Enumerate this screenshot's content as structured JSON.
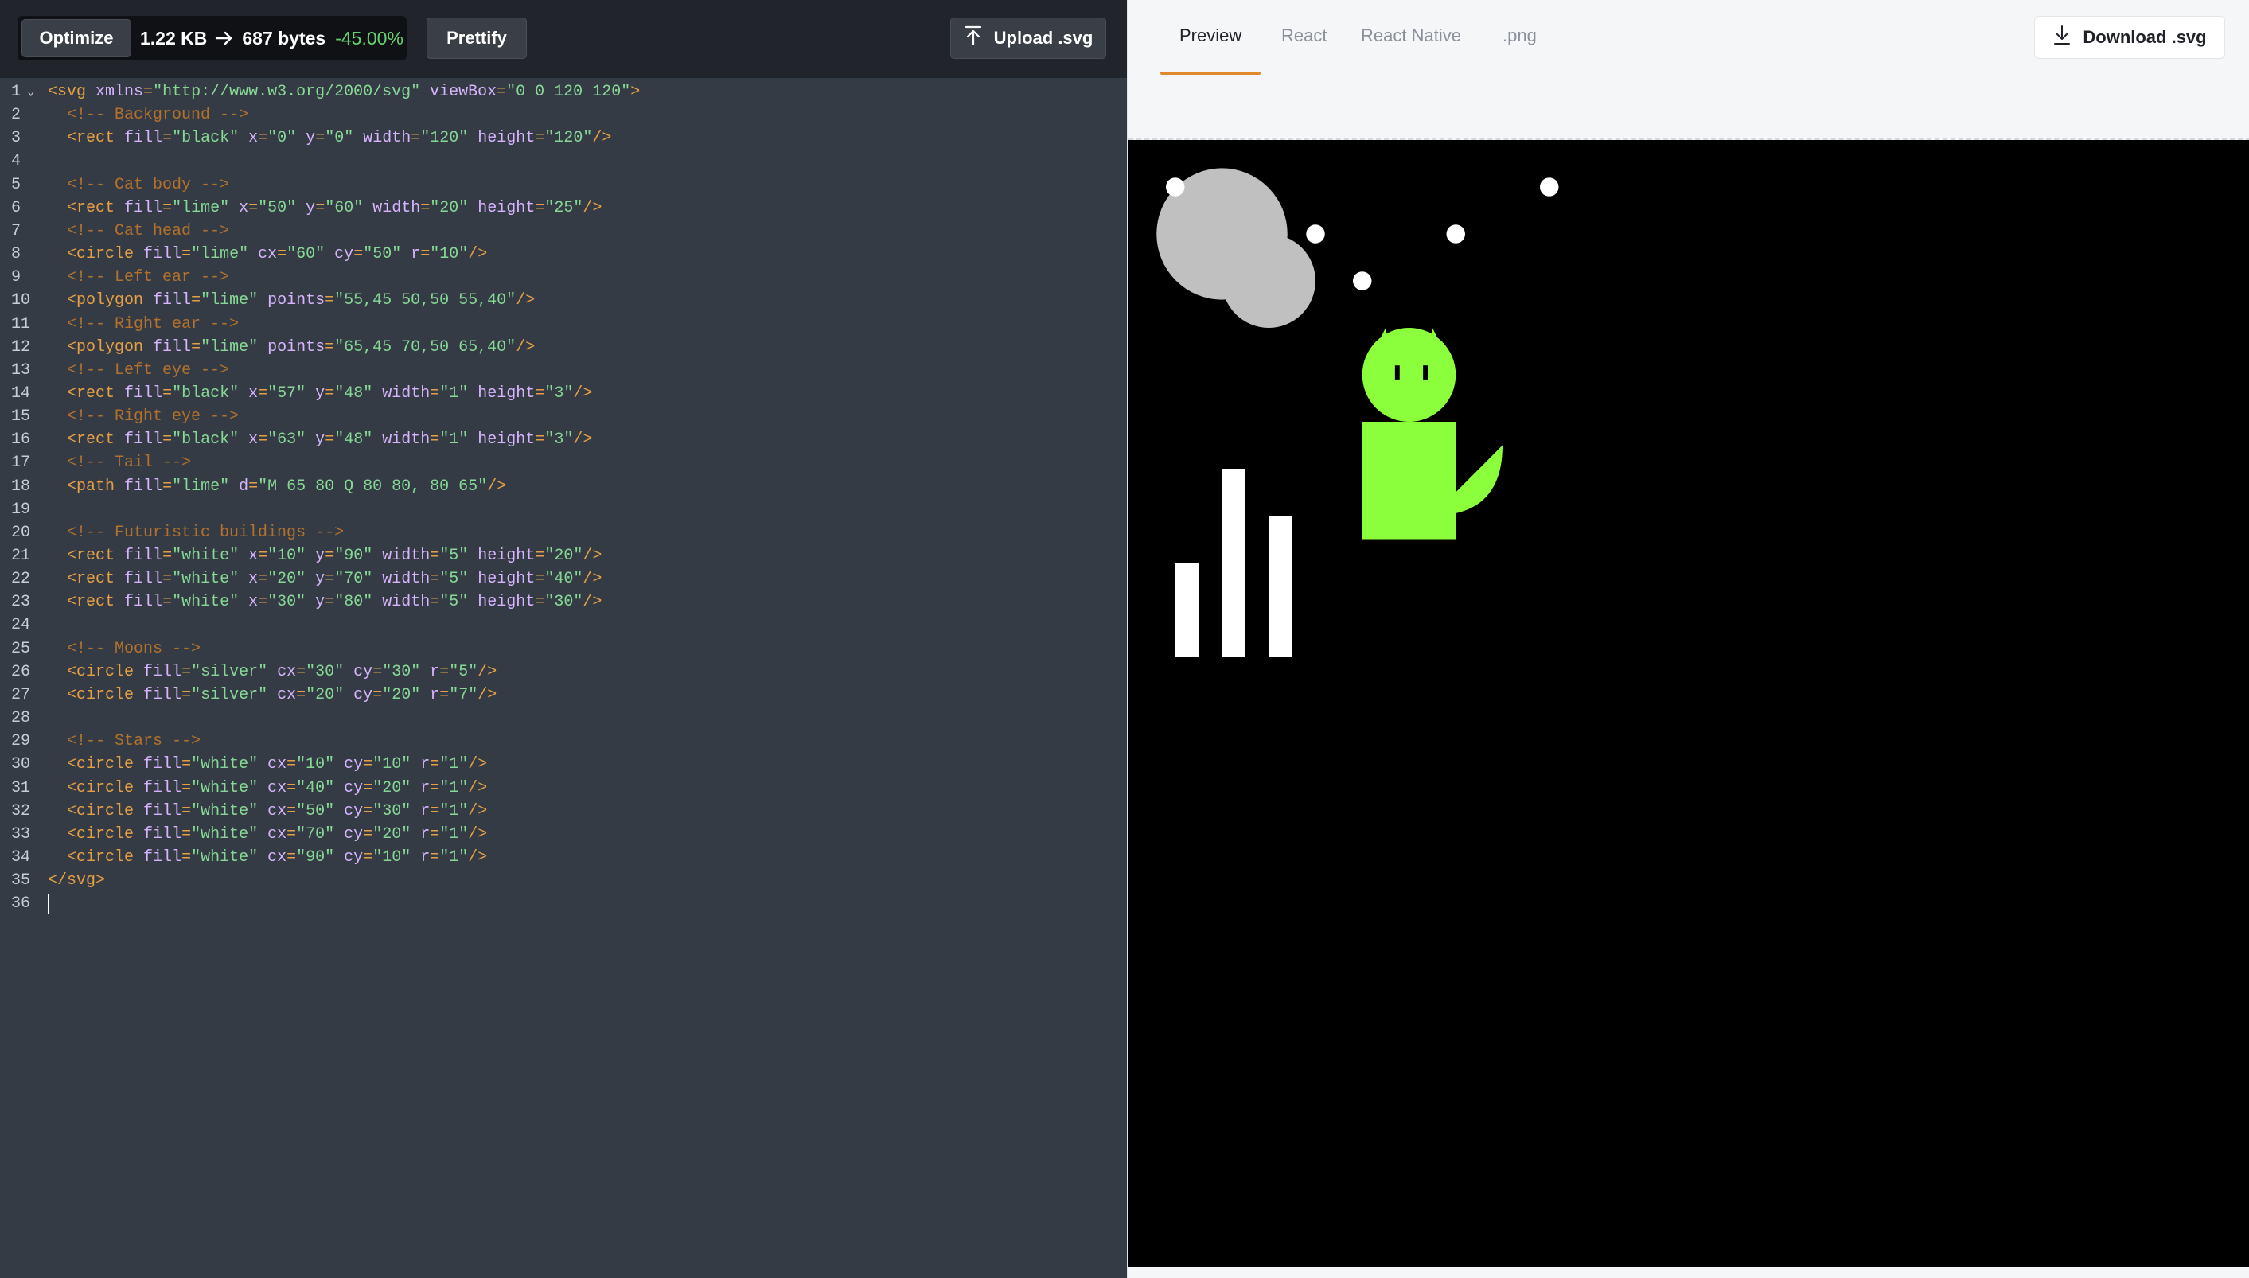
{
  "toolbar": {
    "optimize_label": "Optimize",
    "size_before": "1.22 KB",
    "size_after": "687 bytes",
    "size_change": "-45.00%",
    "prettify_label": "Prettify",
    "upload_label": "Upload .svg",
    "upload_icon": "upload-icon",
    "arrow_icon": "arrow-right-icon"
  },
  "editor": {
    "line_numbers": [
      "1",
      "2",
      "3",
      "4",
      "5",
      "6",
      "7",
      "8",
      "9",
      "10",
      "11",
      "12",
      "13",
      "14",
      "15",
      "16",
      "17",
      "18",
      "19",
      "20",
      "21",
      "22",
      "23",
      "24",
      "25",
      "26",
      "27",
      "28",
      "29",
      "30",
      "31",
      "32",
      "33",
      "34",
      "35",
      "36"
    ],
    "fold_icon": "chevron-down-icon",
    "lines": [
      "<svg xmlns=\"http://www.w3.org/2000/svg\" viewBox=\"0 0 120 120\">",
      "  <!-- Background -->",
      "  <rect fill=\"black\" x=\"0\" y=\"0\" width=\"120\" height=\"120\"/>",
      "",
      "  <!-- Cat body -->",
      "  <rect fill=\"lime\" x=\"50\" y=\"60\" width=\"20\" height=\"25\"/>",
      "  <!-- Cat head -->",
      "  <circle fill=\"lime\" cx=\"60\" cy=\"50\" r=\"10\"/>",
      "  <!-- Left ear -->",
      "  <polygon fill=\"lime\" points=\"55,45 50,50 55,40\"/>",
      "  <!-- Right ear -->",
      "  <polygon fill=\"lime\" points=\"65,45 70,50 65,40\"/>",
      "  <!-- Left eye -->",
      "  <rect fill=\"black\" x=\"57\" y=\"48\" width=\"1\" height=\"3\"/>",
      "  <!-- Right eye -->",
      "  <rect fill=\"black\" x=\"63\" y=\"48\" width=\"1\" height=\"3\"/>",
      "  <!-- Tail -->",
      "  <path fill=\"lime\" d=\"M 65 80 Q 80 80, 80 65\"/>",
      "",
      "  <!-- Futuristic buildings -->",
      "  <rect fill=\"white\" x=\"10\" y=\"90\" width=\"5\" height=\"20\"/>",
      "  <rect fill=\"white\" x=\"20\" y=\"70\" width=\"5\" height=\"40\"/>",
      "  <rect fill=\"white\" x=\"30\" y=\"80\" width=\"5\" height=\"30\"/>",
      "",
      "  <!-- Moons -->",
      "  <circle fill=\"silver\" cx=\"30\" cy=\"30\" r=\"5\"/>",
      "  <circle fill=\"silver\" cx=\"20\" cy=\"20\" r=\"7\"/>",
      "",
      "  <!-- Stars -->",
      "  <circle fill=\"white\" cx=\"10\" cy=\"10\" r=\"1\"/>",
      "  <circle fill=\"white\" cx=\"40\" cy=\"20\" r=\"1\"/>",
      "  <circle fill=\"white\" cx=\"50\" cy=\"30\" r=\"1\"/>",
      "  <circle fill=\"white\" cx=\"70\" cy=\"20\" r=\"1\"/>",
      "  <circle fill=\"white\" cx=\"90\" cy=\"10\" r=\"1\"/>",
      "</svg>",
      ""
    ]
  },
  "preview": {
    "tabs": [
      {
        "label": "Preview",
        "active": true
      },
      {
        "label": "React",
        "active": false
      },
      {
        "label": "React Native",
        "active": false
      },
      {
        "label": ".png",
        "active": false
      }
    ],
    "download_label": "Download .svg",
    "download_icon": "download-icon"
  },
  "colors": {
    "accent": "#e08a2c",
    "size_change": "#65d26f",
    "tag": "#e5a045",
    "attr": "#d8b4fe",
    "string": "#86d995",
    "comment": "#b2712c",
    "lime": "#8cff3c",
    "silver": "#c0c0c0"
  }
}
